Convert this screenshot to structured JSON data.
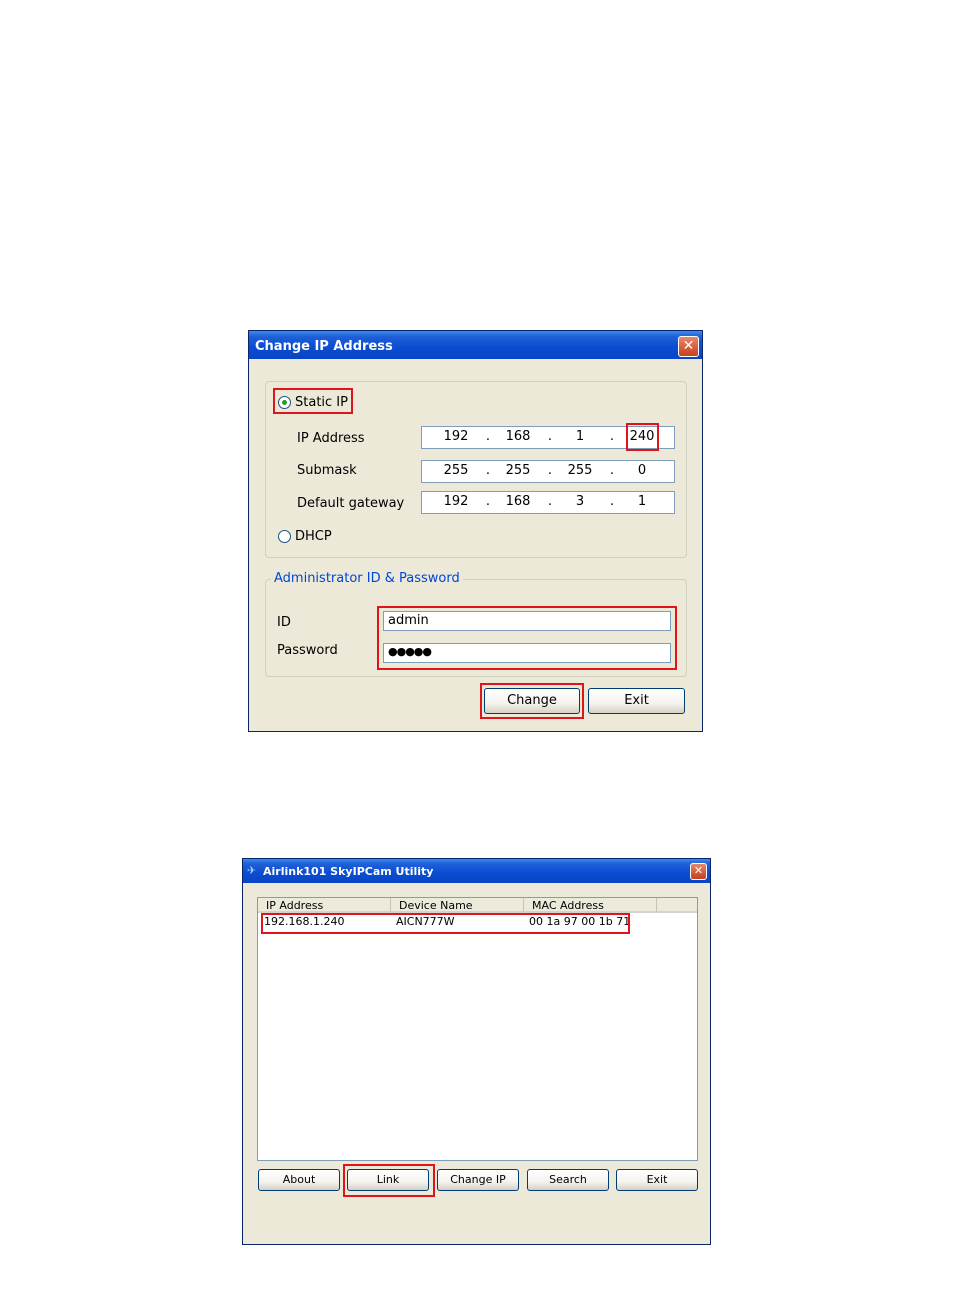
{
  "change_ip_dialog": {
    "title": "Change IP Address",
    "static_ip_label": "Static IP",
    "ip_address_label": "IP Address",
    "ip_address": [
      "192",
      "168",
      "1",
      "240"
    ],
    "submask_label": "Submask",
    "submask": [
      "255",
      "255",
      "255",
      "0"
    ],
    "gateway_label": "Default gateway",
    "gateway": [
      "192",
      "168",
      "3",
      "1"
    ],
    "dhcp_label": "DHCP",
    "admin_group_label": "Administrator ID & Password",
    "id_label": "ID",
    "id_value": "admin",
    "password_label": "Password",
    "password_value": "●●●●●",
    "change_button": "Change",
    "exit_button": "Exit",
    "ip_separator": "."
  },
  "utility_window": {
    "title": "Airlink101 SkyIPCam Utility",
    "columns": [
      "IP Address",
      "Device Name",
      "MAC Address"
    ],
    "rows": [
      {
        "ip": "192.168.1.240",
        "device": "AICN777W",
        "mac": "00 1a 97 00 1b 71"
      }
    ],
    "buttons": {
      "about": "About",
      "link": "Link",
      "change_ip": "Change IP",
      "search": "Search",
      "exit": "Exit"
    }
  },
  "colors": {
    "highlight_box": "#e0141b",
    "titlebar": "#0a4cd1",
    "dialog_bg": "#ece9d8",
    "group_label": "#0046d5"
  }
}
